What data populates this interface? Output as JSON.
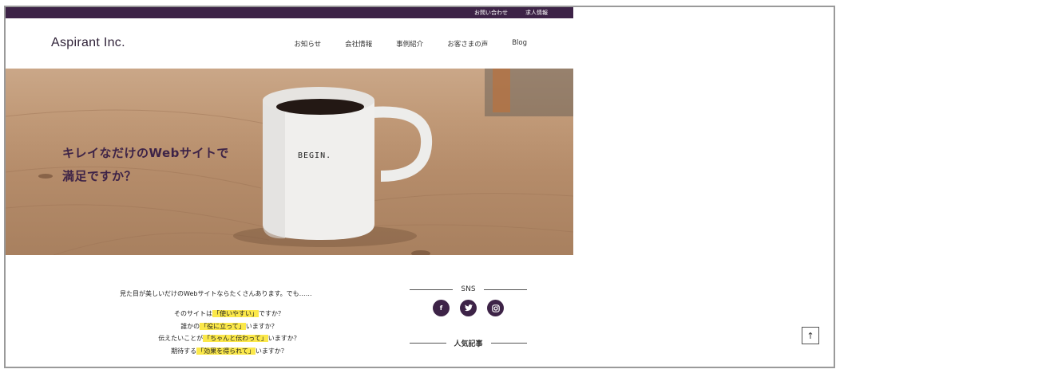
{
  "topbar": {
    "links": [
      "お問い合わせ",
      "求人情報"
    ]
  },
  "header": {
    "logo": "Aspirant Inc.",
    "nav": [
      "お知らせ",
      "会社情報",
      "事例紹介",
      "お客さまの声",
      "Blog"
    ]
  },
  "hero": {
    "title_line1": "キレイなだけのWebサイトで",
    "title_line2": "満足ですか？",
    "mug_text": "BEGIN."
  },
  "intro": {
    "lead": "見た目が美しいだけのWebサイトならたくさんあります。でも……",
    "questions": [
      {
        "pre": "そのサイトは",
        "hl": "「使いやすい」",
        "post": "ですか？"
      },
      {
        "pre": "誰かの",
        "hl": "「役に立って」",
        "post": "いますか？"
      },
      {
        "pre": "伝えたいことが",
        "hl": "「ちゃんと伝わって」",
        "post": "いますか？"
      },
      {
        "pre": "期待する",
        "hl": "「効果を得られて」",
        "post": "いますか？"
      }
    ]
  },
  "sidebar": {
    "sns_heading": "SNS",
    "sns_icons": [
      "facebook-icon",
      "twitter-icon",
      "instagram-icon"
    ],
    "popular_heading": "人気記事"
  },
  "back_to_top": "↑"
}
